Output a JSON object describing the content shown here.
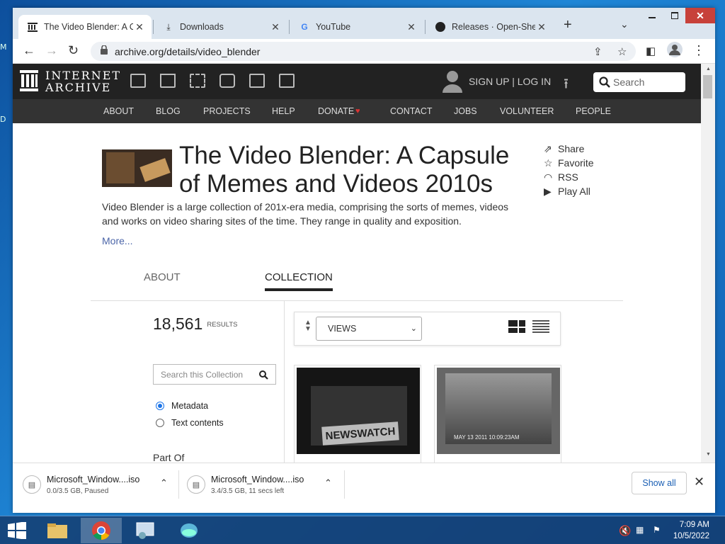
{
  "desktop": {
    "left_letters": [
      "M",
      "D"
    ]
  },
  "browser": {
    "tabs": [
      {
        "title": "The Video Blender: A Ca",
        "active": true
      },
      {
        "title": "Downloads"
      },
      {
        "title": "YouTube"
      },
      {
        "title": "Releases · Open-Shell/O"
      }
    ],
    "address": "archive.org/details/video_blender"
  },
  "ia": {
    "logo_line1": "INTERNET",
    "logo_line2": "ARCHIVE",
    "signup": "SIGN UP | LOG IN",
    "search_placeholder": "Search",
    "nav": [
      "ABOUT",
      "BLOG",
      "PROJECTS",
      "HELP",
      "DONATE",
      "CONTACT",
      "JOBS",
      "VOLUNTEER",
      "PEOPLE"
    ]
  },
  "collection": {
    "title_line1": "The Video Blender: A Capsule",
    "title_line2": "of Memes and Videos 2010s",
    "description": "Video Blender is a large collection of 201x-era media, comprising the sorts of memes, videos and works on video sharing sites of the time. They range in quality and exposition.",
    "more": "More...",
    "actions": [
      "Share",
      "Favorite",
      "RSS",
      "Play All"
    ],
    "tabs": [
      "ABOUT",
      "COLLECTION"
    ],
    "results_count": "18,561",
    "results_label": "RESULTS",
    "search_placeholder": "Search this Collection",
    "search_options": [
      "Metadata",
      "Text contents"
    ],
    "part_of": "Part Of",
    "sort_by": "VIEWS",
    "tile1_caption": "NEWSWATCH",
    "tile2_caption": "MAY 13 2011  10:09:23AM"
  },
  "downloads": [
    {
      "name": "Microsoft_Window....iso",
      "status": "0.0/3.5 GB, Paused"
    },
    {
      "name": "Microsoft_Window....iso",
      "status": "3.4/3.5 GB, 11 secs left"
    }
  ],
  "downloads_show_all": "Show all",
  "taskbar": {
    "time": "7:09 AM",
    "date": "10/5/2022"
  }
}
